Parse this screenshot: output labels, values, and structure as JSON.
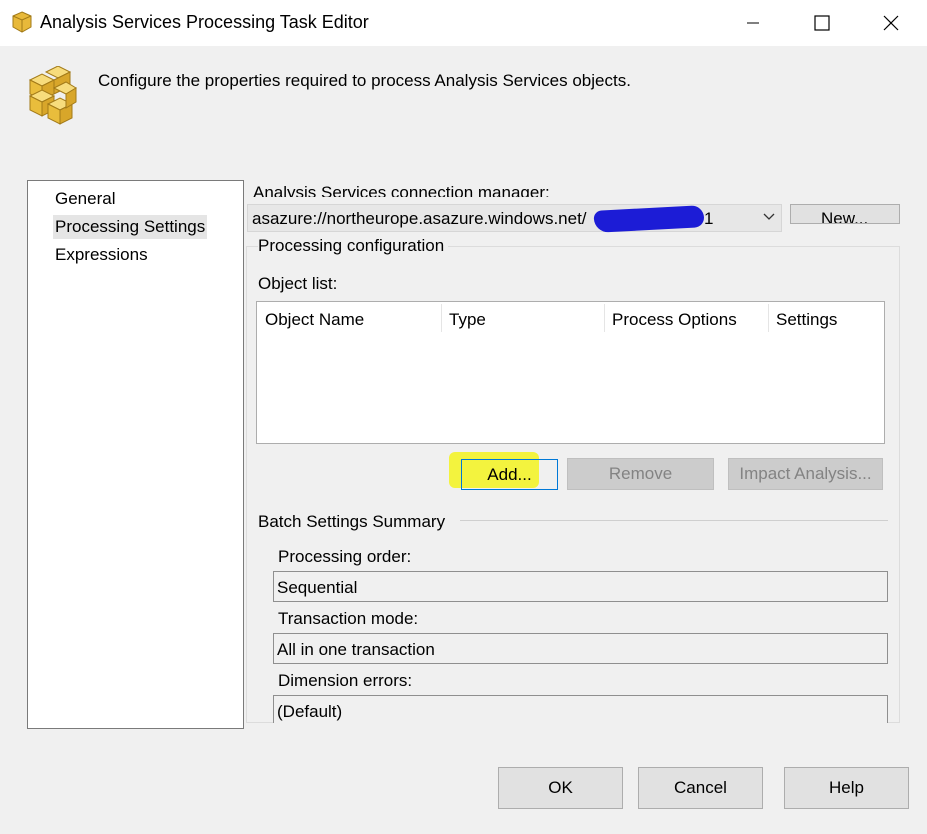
{
  "window": {
    "title": "Analysis Services Processing Task Editor",
    "icon": "cube-icon"
  },
  "header": {
    "description": "Configure the properties required to process Analysis Services objects.",
    "icon": "cubes-icon"
  },
  "nav": {
    "items": [
      {
        "label": "General",
        "selected": false
      },
      {
        "label": "Processing Settings",
        "selected": true
      },
      {
        "label": "Expressions",
        "selected": false
      }
    ]
  },
  "connection": {
    "label": "Analysis Services connection manager:",
    "value": "asazure://northeurope.asazure.windows.net/",
    "value_suffix": "1",
    "new_label": "New..."
  },
  "processing": {
    "group_label": "Processing configuration",
    "object_list_label": "Object list:",
    "columns": [
      "Object Name",
      "Type",
      "Process Options",
      "Settings"
    ],
    "rows": [],
    "add_label": "Add...",
    "remove_label": "Remove",
    "impact_label": "Impact Analysis..."
  },
  "batch": {
    "title": "Batch Settings Summary",
    "processing_order_label": "Processing order:",
    "processing_order_value": "Sequential",
    "transaction_mode_label": "Transaction mode:",
    "transaction_mode_value": "All in one transaction",
    "dimension_errors_label": "Dimension errors:",
    "dimension_errors_value": "(Default)"
  },
  "footer": {
    "ok_label": "OK",
    "cancel_label": "Cancel",
    "help_label": "Help"
  },
  "colors": {
    "highlight": "#f3f31e",
    "focus_border": "#0078d7",
    "redaction": "#1c1cd6"
  }
}
